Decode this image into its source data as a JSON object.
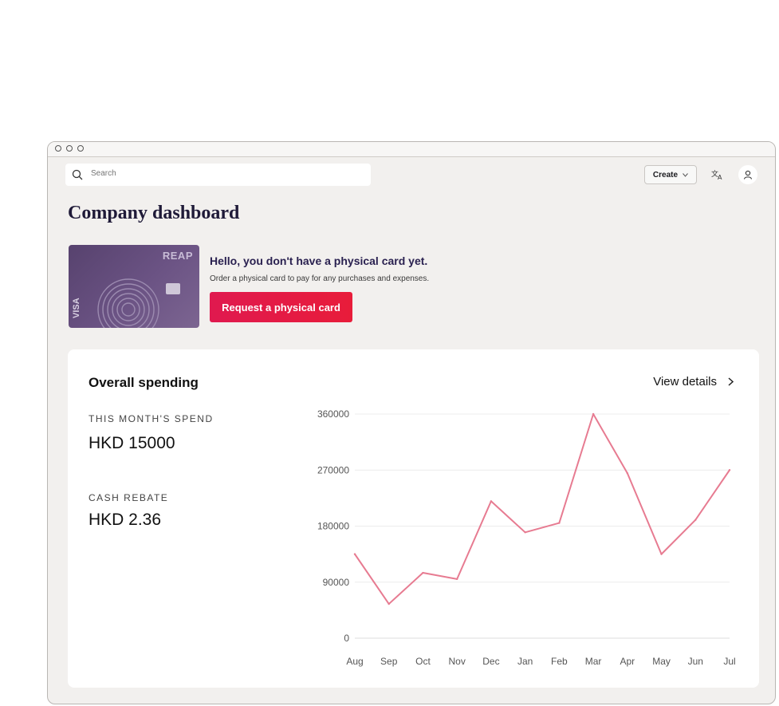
{
  "search": {
    "placeholder": "Search"
  },
  "header": {
    "create_label": "Create",
    "create_chevron": "chevron-down-icon",
    "translate_icon": "translate-icon",
    "account_icon": "user-icon"
  },
  "page": {
    "title": "Company dashboard"
  },
  "card": {
    "brand": "REAP",
    "network": "VISA"
  },
  "promo": {
    "title": "Hello, you don't have a physical card yet.",
    "description": "Order a physical card to pay for any purchases and expenses.",
    "button_label": "Request a physical card"
  },
  "spending": {
    "title": "Overall spending",
    "view_details": "View details",
    "month_label": "THIS MONTH'S SPEND",
    "month_value": "HKD 15000",
    "rebate_label": "CASH REBATE",
    "rebate_value": "HKD 2.36"
  },
  "colors": {
    "accent": "#e8195a",
    "line": "#e77b91",
    "title": "#1f1a38"
  },
  "chart_data": {
    "type": "line",
    "categories": [
      "Aug",
      "Sep",
      "Oct",
      "Nov",
      "Dec",
      "Jan",
      "Feb",
      "Mar",
      "Apr",
      "May",
      "Jun",
      "Jul"
    ],
    "values": [
      135000,
      55000,
      105000,
      95000,
      220000,
      170000,
      185000,
      360000,
      265000,
      135000,
      190000,
      270000
    ],
    "yticks": [
      0,
      90000,
      180000,
      270000,
      360000
    ],
    "ylim": [
      0,
      360000
    ],
    "grid": true
  }
}
